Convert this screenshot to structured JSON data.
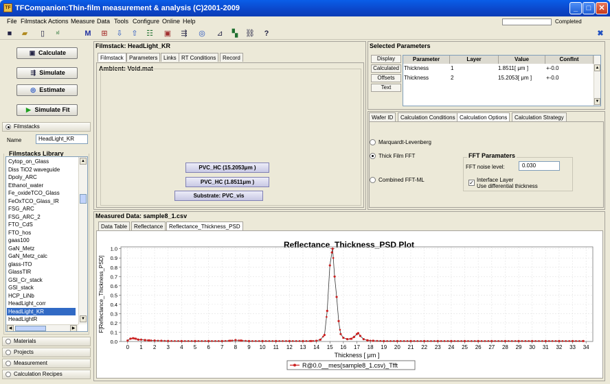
{
  "window": {
    "title": "TFCompanion:Thin-film measurement & analysis (C)2001-2009",
    "app_icon": "TF"
  },
  "menu": [
    "File",
    "Filmstack",
    "Actions",
    "Measure",
    "Data",
    "Tools",
    "Configure",
    "Online",
    "Help"
  ],
  "status": {
    "completed_label": "Completed"
  },
  "toolbar_icons": [
    "save-icon",
    "open-folder-icon",
    "new-document-icon",
    "excel-icon",
    "m-icon",
    "add-layer-icon",
    "arrow-down-icon",
    "arrow-up-icon",
    "list-icon",
    "calculate-icon",
    "simulate-icon",
    "estimate-icon",
    "layer-tool-icon",
    "filmstack-icon",
    "link-icon",
    "help-icon"
  ],
  "actions": {
    "calculate": "Calculate",
    "simulate": "Simulate",
    "estimate": "Estimate",
    "simulate_fit": "Simulate Fit"
  },
  "left": {
    "filmstacks_tab": "Filmstacks",
    "name_label": "Name",
    "name_value": "HeadLight_KR",
    "library_title": "Filmstacks Library",
    "library_items": [
      "Cytop_on_Glass",
      "Diss TiO2 waveguide",
      "Dpoly_ARC",
      "Ethanol_water",
      "Fe_oxideTCO_Glass",
      "FeOxTCO_Glass_IR",
      "FSG_ARC",
      "FSG_ARC_2",
      "FTO_CdS",
      "FTO_hos",
      "gaas100",
      "GaN_Metz",
      "GaN_Metz_calc",
      "glass-ITO",
      "GlassTIR",
      "GSI_Cr_stack",
      "GSI_stack",
      "HCP_LiNb",
      "HeadLight_corr",
      "HeadLight_KR",
      "HeadLightR"
    ],
    "selected_item": "HeadLight_KR",
    "bottom_tabs": [
      "Materials",
      "Projects",
      "Measurement",
      "Calculation Recipes"
    ]
  },
  "filmstack": {
    "header": "Filmstack: HeadLight_KR",
    "tabs": [
      "Filmstack",
      "Parameters",
      "Links",
      "RT Conditions",
      "Record"
    ],
    "ambient": "Ambient: Void.mat",
    "layers": [
      "PVC_HC (15.2053μm )",
      "PVC_HC (1.8511μm )"
    ],
    "substrate": "Substrate: PVC_vis"
  },
  "selected_params": {
    "header": "Selected Parameters",
    "side_buttons": [
      "Display",
      "Calculated",
      "Offsets",
      "Text"
    ],
    "columns": [
      "Parameter",
      "Layer",
      "Value",
      "ConfInt"
    ],
    "rows": [
      {
        "parameter": "Thickness",
        "layer": "1",
        "value": "1.8511[ μm ]",
        "confint": "+-0.0"
      },
      {
        "parameter": "Thickness",
        "layer": "2",
        "value": "15.2053[ μm ]",
        "confint": "+-0.0"
      }
    ]
  },
  "options": {
    "tabs": [
      "Wafer ID",
      "Calculation Conditions",
      "Calculation Options",
      "Calculation Strategy"
    ],
    "methods": [
      "Marquardt-Levenberg",
      "Thick Film FFT",
      "Combined FFT-ML"
    ],
    "selected_method": "Thick Film FFT",
    "fft_title": "FFT Paramaters",
    "fft_noise_label": "FFT noise level:",
    "fft_noise_value": "0.030",
    "interface_layer_label": "Interface Layer",
    "differential_label": "Use differential thickness",
    "interface_checked": true
  },
  "measured": {
    "header": "Measured Data: sample8_1.csv",
    "tabs": [
      "Data Table",
      "Reflectance",
      "Reflectance_Thickness_PSD"
    ]
  },
  "chart_data": {
    "type": "line",
    "title": "Reflectance_Thickness_PSD Plot",
    "xlabel": "Thickness [ μm ]",
    "ylabel": "F[Reflectance_Thickness_PSD]",
    "xlim": [
      -0.5,
      34.5
    ],
    "ylim": [
      0,
      1.02
    ],
    "xticks": [
      0,
      1,
      2,
      3,
      4,
      5,
      6,
      7,
      8,
      9,
      10,
      11,
      12,
      13,
      14,
      15,
      16,
      17,
      18,
      19,
      20,
      21,
      22,
      23,
      24,
      25,
      26,
      27,
      28,
      29,
      30,
      31,
      32,
      33,
      34
    ],
    "yticks": [
      0.0,
      0.1,
      0.2,
      0.3,
      0.4,
      0.5,
      0.6,
      0.7,
      0.8,
      0.9,
      1.0
    ],
    "ytick_labels": [
      "0.0",
      "0.1",
      "0.2",
      "0.3",
      "0.4",
      "0.5",
      "0.6",
      "0.7",
      "0.8",
      "0.9",
      "1.0"
    ],
    "color": "#cc2020",
    "legend": "R@0.0__mes(sample8_1.csv)_Tfft",
    "legend_position": "bottom-center",
    "series": [
      {
        "name": "R@0.0__mes(sample8_1.csv)_Tfft",
        "points": [
          [
            0.0,
            0.01
          ],
          [
            0.2,
            0.03
          ],
          [
            0.4,
            0.035
          ],
          [
            0.6,
            0.03
          ],
          [
            0.8,
            0.02
          ],
          [
            1.0,
            0.02
          ],
          [
            1.3,
            0.015
          ],
          [
            1.6,
            0.012
          ],
          [
            2,
            0.01
          ],
          [
            2.5,
            0.008
          ],
          [
            3,
            0.006
          ],
          [
            4,
            0.005
          ],
          [
            5,
            0.005
          ],
          [
            6,
            0.005
          ],
          [
            7,
            0.005
          ],
          [
            7.6,
            0.008
          ],
          [
            8.0,
            0.015
          ],
          [
            8.4,
            0.01
          ],
          [
            9,
            0.005
          ],
          [
            10,
            0.005
          ],
          [
            11,
            0.005
          ],
          [
            12,
            0.005
          ],
          [
            13,
            0.005
          ],
          [
            13.6,
            0.005
          ],
          [
            14.0,
            0.008
          ],
          [
            14.3,
            0.02
          ],
          [
            14.6,
            0.07
          ],
          [
            14.8,
            0.33
          ],
          [
            15.0,
            0.82
          ],
          [
            15.15,
            0.96
          ],
          [
            15.2,
            1.0
          ],
          [
            15.35,
            0.7
          ],
          [
            15.5,
            0.48
          ],
          [
            15.65,
            0.22
          ],
          [
            15.8,
            0.08
          ],
          [
            16.0,
            0.04
          ],
          [
            16.3,
            0.025
          ],
          [
            16.6,
            0.03
          ],
          [
            16.8,
            0.05
          ],
          [
            17.0,
            0.08
          ],
          [
            17.1,
            0.09
          ],
          [
            17.25,
            0.06
          ],
          [
            17.5,
            0.025
          ],
          [
            17.8,
            0.012
          ],
          [
            18.2,
            0.008
          ],
          [
            19,
            0.005
          ],
          [
            20,
            0.005
          ],
          [
            21,
            0.005
          ],
          [
            22,
            0.005
          ],
          [
            23,
            0.005
          ],
          [
            24,
            0.005
          ],
          [
            25,
            0.005
          ],
          [
            26,
            0.005
          ],
          [
            27,
            0.005
          ],
          [
            28,
            0.005
          ],
          [
            29,
            0.005
          ],
          [
            30,
            0.005
          ],
          [
            31,
            0.005
          ],
          [
            32,
            0.005
          ],
          [
            33,
            0.005
          ],
          [
            33.8,
            0.005
          ]
        ]
      }
    ]
  }
}
